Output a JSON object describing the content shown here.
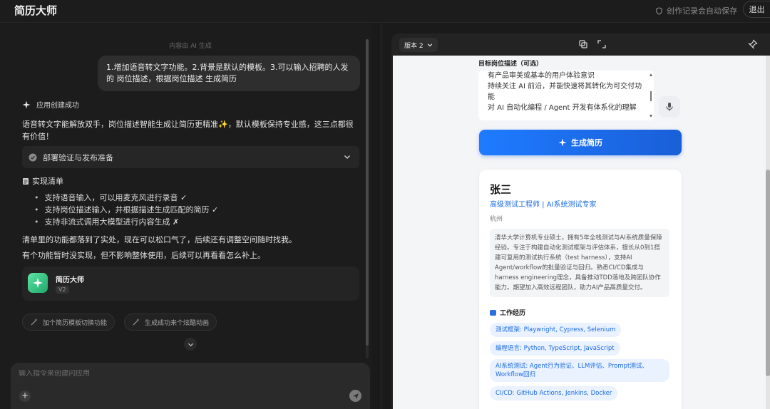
{
  "app": {
    "title": "简历大师",
    "autosave": "创作记录会自动保存",
    "exit": "退出"
  },
  "chat": {
    "ai_note": "内容由 AI 生成",
    "user_message": "1.增加语音转文字功能。2.背景是默认的模板。3.可以输入招聘的人发的 岗位描述，根据岗位描述 生成简历",
    "status": "应用创建成功",
    "reply_intro": "语音转文字能解放双手，岗位描述智能生成让简历更精准✨，默认模板保持专业感，这三点都很有价值！",
    "deploy_label": "部署验证与发布准备",
    "checklist_title": "实现清单",
    "checklist": [
      "支持语音输入，可以用麦克风进行录音 ✓",
      "支持岗位描述输入，并根据描述生成匹配的简历 ✓",
      "支持非流式调用大模型进行内容生成 ✗"
    ],
    "reply_done": "清单里的功能都落到了实处，现在可以松口气了，后续还有调整空间随时找我。",
    "reply_note": "有个功能暂时没实现，但不影响整体使用，后续可以再看看怎么补上。",
    "app_card": {
      "name": "简历大师",
      "version": "V2"
    },
    "suggestions": [
      "加个简历模板切换功能",
      "生成成功来个炫酷动画"
    ],
    "composer_placeholder": "输入指令来创建闪应用"
  },
  "preview": {
    "version_label": "版本 2",
    "jd_label": "目标岗位描述（可选）",
    "jd_text": "有产品审美或基本的用户体验意识\n持续关注 AI 前沿，并能快速将其转化为可交付功能\n对 AI 自动化编程 / Agent 开发有体系化的理解",
    "generate_button": "生成简历",
    "resume": {
      "name": "张三",
      "title": "高级测试工程师 | AI系统测试专家",
      "city": "杭州",
      "summary": "清华大学计算机专业硕士，拥有5年全栈测试与AI系统质量保障经验。专注于构建自动化测试框架与评估体系，擅长从0到1搭建可复用的测试执行系统（test harness），支持AI Agent/workflow的批量验证与回归。熟悉CI/CD集成与harness engineering理念，具备推动TDD落地及跨团队协作能力。期望加入高效远程团队，助力AI产品高质量交付。",
      "section_title": "工作经历",
      "skills": [
        "测试框架: Playwright, Cypress, Selenium",
        "编程语言: Python, TypeScript, JavaScript",
        "AI系统测试: Agent行为验证、LLM评估、Prompt测试、Workflow回归",
        "CI/CD: GitHub Actions, Jenkins, Docker"
      ]
    }
  },
  "colors": {
    "accent": "#1a6be0",
    "bg_dark": "#1c1c1c",
    "canvas": "#f4f5f7"
  }
}
